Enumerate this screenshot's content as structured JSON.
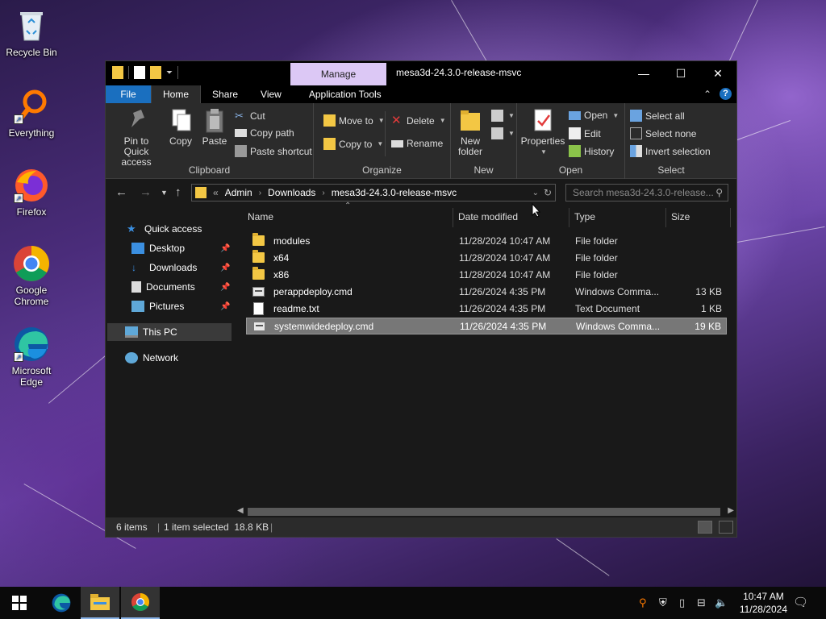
{
  "desktop": {
    "icons": [
      {
        "label": "Recycle Bin"
      },
      {
        "label": "Everything"
      },
      {
        "label": "Firefox"
      },
      {
        "label": "Google Chrome"
      },
      {
        "label": "Microsoft Edge"
      }
    ]
  },
  "window": {
    "manage_tab": "Manage",
    "title": "mesa3d-24.3.0-release-msvc",
    "controls": {
      "minimize": "—",
      "maximize": "☐",
      "close": "✕"
    }
  },
  "ribbon_tabs": [
    "File",
    "Home",
    "Share",
    "View",
    "Application Tools"
  ],
  "ribbon": {
    "clipboard": {
      "label": "Clipboard",
      "pin": "Pin to Quick access",
      "copy": "Copy",
      "paste": "Paste",
      "cut": "Cut",
      "copy_path": "Copy path",
      "paste_shortcut": "Paste shortcut"
    },
    "organize": {
      "label": "Organize",
      "move_to": "Move to",
      "copy_to": "Copy to",
      "delete": "Delete",
      "rename": "Rename"
    },
    "new": {
      "label": "New",
      "new_folder": "New folder"
    },
    "open": {
      "label": "Open",
      "properties": "Properties",
      "open": "Open",
      "edit": "Edit",
      "history": "History"
    },
    "select": {
      "label": "Select",
      "select_all": "Select all",
      "select_none": "Select none",
      "invert": "Invert selection"
    }
  },
  "address": {
    "prefix": "«",
    "crumbs": [
      "Admin",
      "Downloads",
      "mesa3d-24.3.0-release-msvc"
    ],
    "search_placeholder": "Search mesa3d-24.3.0-release..."
  },
  "nav": {
    "quick_access": "Quick access",
    "desktop": "Desktop",
    "downloads": "Downloads",
    "documents": "Documents",
    "pictures": "Pictures",
    "this_pc": "This PC",
    "network": "Network"
  },
  "columns": {
    "name": "Name",
    "date": "Date modified",
    "type": "Type",
    "size": "Size"
  },
  "files": [
    {
      "name": "modules",
      "date": "11/28/2024 10:47 AM",
      "type": "File folder",
      "size": "",
      "kind": "folder"
    },
    {
      "name": "x64",
      "date": "11/28/2024 10:47 AM",
      "type": "File folder",
      "size": "",
      "kind": "folder"
    },
    {
      "name": "x86",
      "date": "11/28/2024 10:47 AM",
      "type": "File folder",
      "size": "",
      "kind": "folder"
    },
    {
      "name": "perappdeploy.cmd",
      "date": "11/26/2024 4:35 PM",
      "type": "Windows Comma...",
      "size": "13 KB",
      "kind": "cmd"
    },
    {
      "name": "readme.txt",
      "date": "11/26/2024 4:35 PM",
      "type": "Text Document",
      "size": "1 KB",
      "kind": "txt"
    },
    {
      "name": "systemwidedeploy.cmd",
      "date": "11/26/2024 4:35 PM",
      "type": "Windows Comma...",
      "size": "19 KB",
      "kind": "cmd",
      "selected": true
    }
  ],
  "status": {
    "items": "6 items",
    "selected": "1 item selected  18.8 KB"
  },
  "taskbar": {
    "time": "10:47 AM",
    "date": "11/28/2024"
  },
  "colors": {
    "accent": "#1a6fbf",
    "manage": "#dcc8f5",
    "folder": "#f3c744"
  }
}
